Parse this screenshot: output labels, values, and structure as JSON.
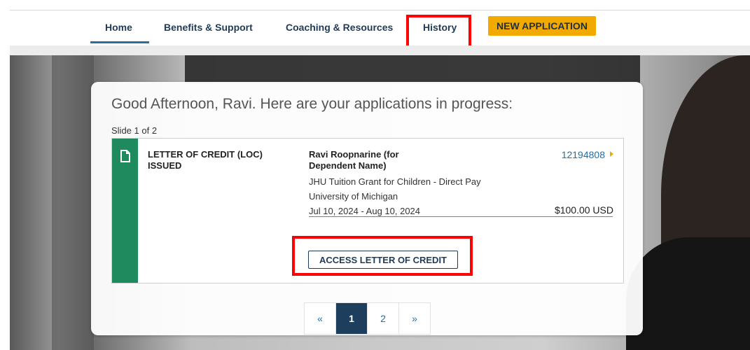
{
  "nav": {
    "home": "Home",
    "benefits": "Benefits & Support",
    "coaching": "Coaching & Resources",
    "history": "History",
    "new_application": "NEW APPLICATION"
  },
  "card": {
    "greeting": "Good Afternoon, Ravi. Here are your applications in progress:",
    "slide_indicator": "Slide 1 of 2",
    "application": {
      "icon": "document-icon",
      "status_line1": "LETTER OF CREDIT (LOC)",
      "status_line2": "ISSUED",
      "applicant_line1": "Ravi Roopnarine (for",
      "applicant_line2": "Dependent Name)",
      "grant": "JHU Tuition Grant for Children - Direct Pay",
      "university": "University of Michigan",
      "dates": "Jul 10, 2024 - Aug 10, 2024",
      "number": "12194808",
      "amount": "$100.00 USD",
      "action_label": "ACCESS LETTER OF CREDIT"
    }
  },
  "pagination": {
    "prev": "«",
    "pages": [
      "1",
      "2"
    ],
    "active": "1",
    "next": "»"
  },
  "colors": {
    "accent_yellow": "#f2a900",
    "status_green": "#1e8a5e",
    "navy": "#1d3e5c",
    "highlight_red": "#ff0000"
  }
}
